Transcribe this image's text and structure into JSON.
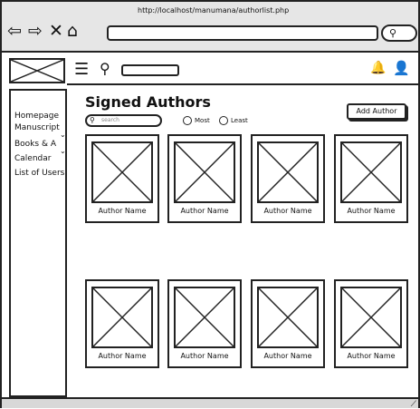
{
  "browser": {
    "url": "http://localhost/manumana/authorlist.php",
    "buttons": [
      "back",
      "forward",
      "stop",
      "home"
    ]
  },
  "sidebar": {
    "items": [
      {
        "label": "Homepage"
      },
      {
        "label": "Manuscript"
      },
      {
        "label": "Books & A"
      },
      {
        "label": "Calendar"
      },
      {
        "label": "List of Users"
      }
    ]
  },
  "main": {
    "title": "Signed Authors",
    "search_placeholder": "search",
    "filters": [
      {
        "label": "Most"
      },
      {
        "label": "Least"
      }
    ],
    "add_button": "Add Author",
    "authors": [
      {
        "name": "Author Name"
      },
      {
        "name": "Author Name"
      },
      {
        "name": "Author Name"
      },
      {
        "name": "Author Name"
      },
      {
        "name": "Author Name"
      },
      {
        "name": "Author Name"
      },
      {
        "name": "Author Name"
      },
      {
        "name": "Author Name"
      }
    ]
  },
  "icons": {
    "back": "back-arrow-icon",
    "forward": "forward-arrow-icon",
    "stop": "close-icon",
    "home": "home-icon",
    "menu": "hamburger-menu-icon",
    "search": "search-icon",
    "bell": "bell-icon",
    "user": "user-icon"
  }
}
